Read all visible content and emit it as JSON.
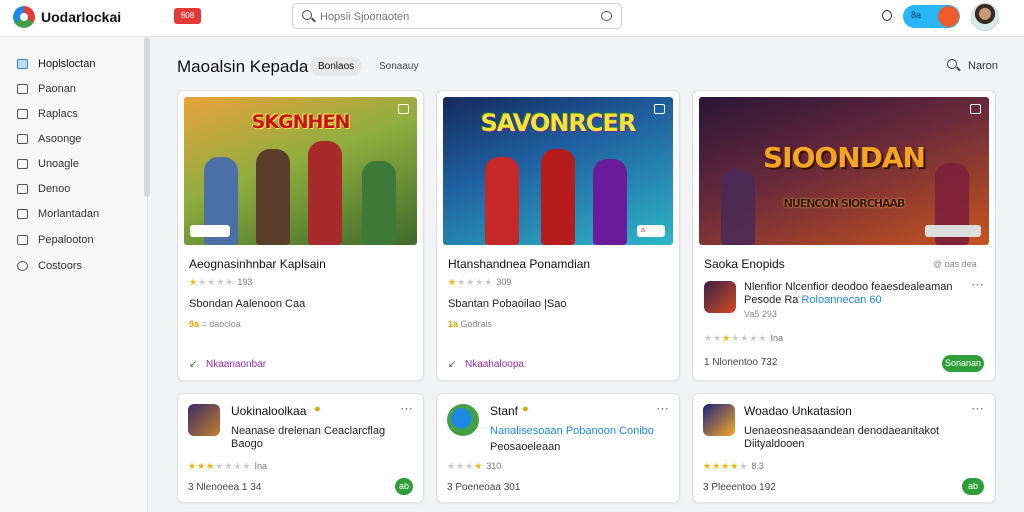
{
  "app": {
    "title": "Uodarlockai",
    "badge": "808"
  },
  "search": {
    "placeholder": "Hopsii Sjoonaoten"
  },
  "header_pill": {
    "label": "8a"
  },
  "sidebar": {
    "items": [
      {
        "label": "Hoplsloctan",
        "active": true
      },
      {
        "label": "Paonan"
      },
      {
        "label": "Raplacs"
      },
      {
        "label": "Asoonge"
      },
      {
        "label": "Unoagle"
      },
      {
        "label": "Denoo"
      },
      {
        "label": "Morlantadan"
      },
      {
        "label": "Pepalooton"
      },
      {
        "label": "Costoors"
      }
    ]
  },
  "main": {
    "title": "Maoalsin Kepada",
    "chips": [
      "Bonlaos",
      "Sonaauy"
    ],
    "filter_label": "Naron"
  },
  "featured": [
    {
      "banner_text": "SKGNHEN",
      "title": "Aeognasinhnbar Kaplsain",
      "rating": 1,
      "rating_text": "193",
      "subtitle": "Sbondan Aalenoon Caa",
      "meta_prefix": "9a",
      "meta_text": "= daocloa",
      "link": "Nkaanaonbar",
      "colors": [
        "#d98a2b",
        "#5a7a32"
      ]
    },
    {
      "banner_text": "SAVONRCER",
      "title": "Htanshandnea Ponamdian",
      "rating": 1,
      "rating_text": "309",
      "subtitle": "Sbantan Pobaoilao |Sao",
      "meta_prefix": "1a",
      "meta_text": "Godrais",
      "link": "Nkaahaloopa",
      "tag": "a",
      "colors": [
        "#1b3a7a",
        "#2fb7c9"
      ]
    },
    {
      "banner_text": "SIOONDAN",
      "banner_sub": "NUENCON SIORCHAAB",
      "title": "Saoka Enopids",
      "title_meta": "@ oas dea",
      "thumb_desc_1": "Nlenfior Nlcenfior deodoo feaesdealeaman",
      "thumb_desc_2a": "Pesode Ra",
      "thumb_desc_2b": "Roloannecan 60",
      "thumb_desc_3": "Va5 293",
      "rating": 1,
      "rating_text": "Ina",
      "footer": "1 Nlonentoo 732",
      "button": "Sonanan",
      "colors": [
        "#3b1f4a",
        "#d24b1f"
      ]
    }
  ],
  "apps": [
    {
      "title": "Uokinaloolkaa",
      "desc_1": "Neanase drelenan Ceaclarcflag",
      "desc_2": "Baogo",
      "rating": 3,
      "rating_text": "Ina",
      "footer": "3 Nlenoeea 1 34",
      "button": "ab",
      "thumb": [
        "#3a2a6a",
        "#c0802a"
      ]
    },
    {
      "title": "Stanf",
      "desc_1": "Nanalisesoaan Pobanoon Conibo",
      "desc_2": "Peosaoeleaan",
      "rating": 1,
      "rating_text": "310",
      "footer": "3 Poeneoaa 301",
      "button": "",
      "thumb": [
        "#1e88e5",
        "#43a047"
      ]
    },
    {
      "title": "Woadao Unkatasion",
      "desc_1": "Uenaeosneasaandean denodaeanitakot",
      "desc_2": "Diityaldooen",
      "rating": 3,
      "rating_text": "8.3",
      "footer": "3 Pleeentoo 192",
      "button": "ab",
      "thumb": [
        "#1a237e",
        "#f9a825"
      ]
    }
  ]
}
